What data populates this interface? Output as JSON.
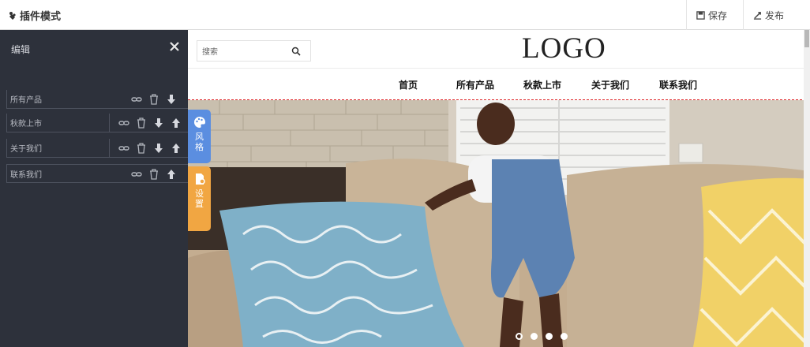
{
  "topbar": {
    "title": "插件模式",
    "save_label": "保存",
    "publish_label": "发布"
  },
  "editor": {
    "heading": "编辑",
    "items": [
      {
        "label": "所有产品"
      },
      {
        "label": "秋款上市"
      },
      {
        "label": "关于我们"
      },
      {
        "label": "联系我们"
      }
    ]
  },
  "side_tabs": {
    "style": [
      "风",
      "格"
    ],
    "settings": [
      "设",
      "置"
    ]
  },
  "preview": {
    "search_placeholder": "搜索",
    "logo": "LOGO",
    "nav": [
      "首页",
      "所有产品",
      "秋款上市",
      "关于我们",
      "联系我们"
    ],
    "carousel": {
      "slides": 4,
      "active": 1
    }
  },
  "colors": {
    "editor_bg": "#2d313b",
    "style_tab": "#5b8ee0",
    "settings_tab": "#f1a642",
    "section_outline": "#e0292b"
  }
}
